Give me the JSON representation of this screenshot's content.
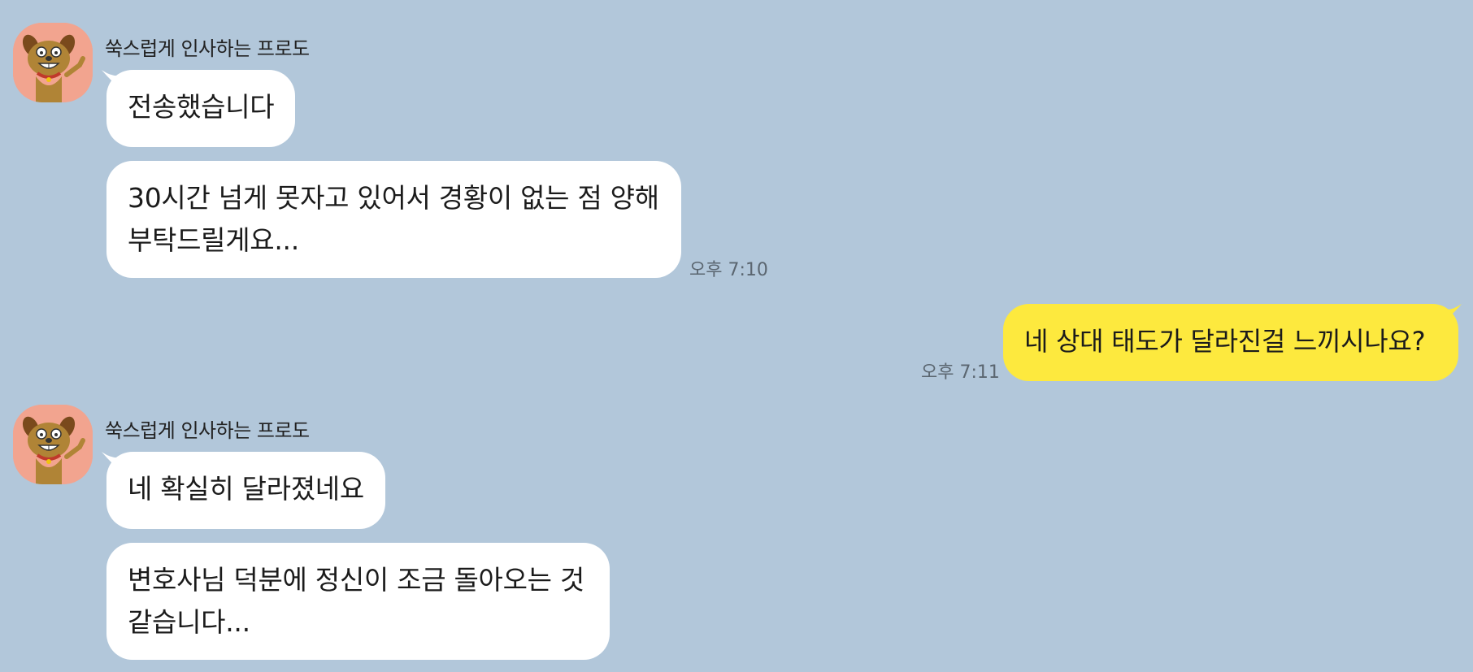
{
  "chat": {
    "background_color": "#b2c7da",
    "incoming_bubble_color": "#ffffff",
    "outgoing_bubble_color": "#fde93e",
    "groups": [
      {
        "sender": "쑥스럽게 인사하는 프로도",
        "avatar_icon": "frodo-dog-avatar-icon",
        "messages": [
          "전송했습니다",
          "30시간 넘게 못자고 있어서 경황이 없는 점 양해 부탁드릴게요..."
        ],
        "time": "오후 7:10"
      },
      {
        "mine": true,
        "messages": [
          "네 상대 태도가 달라진걸 느끼시나요?"
        ],
        "time": "오후 7:11"
      },
      {
        "sender": "쑥스럽게 인사하는 프로도",
        "avatar_icon": "frodo-dog-avatar-icon",
        "messages": [
          "네 확실히 달라졌네요",
          "변호사님 덕분에 정신이 조금 돌아오는 것 같습니다..."
        ]
      }
    ]
  }
}
